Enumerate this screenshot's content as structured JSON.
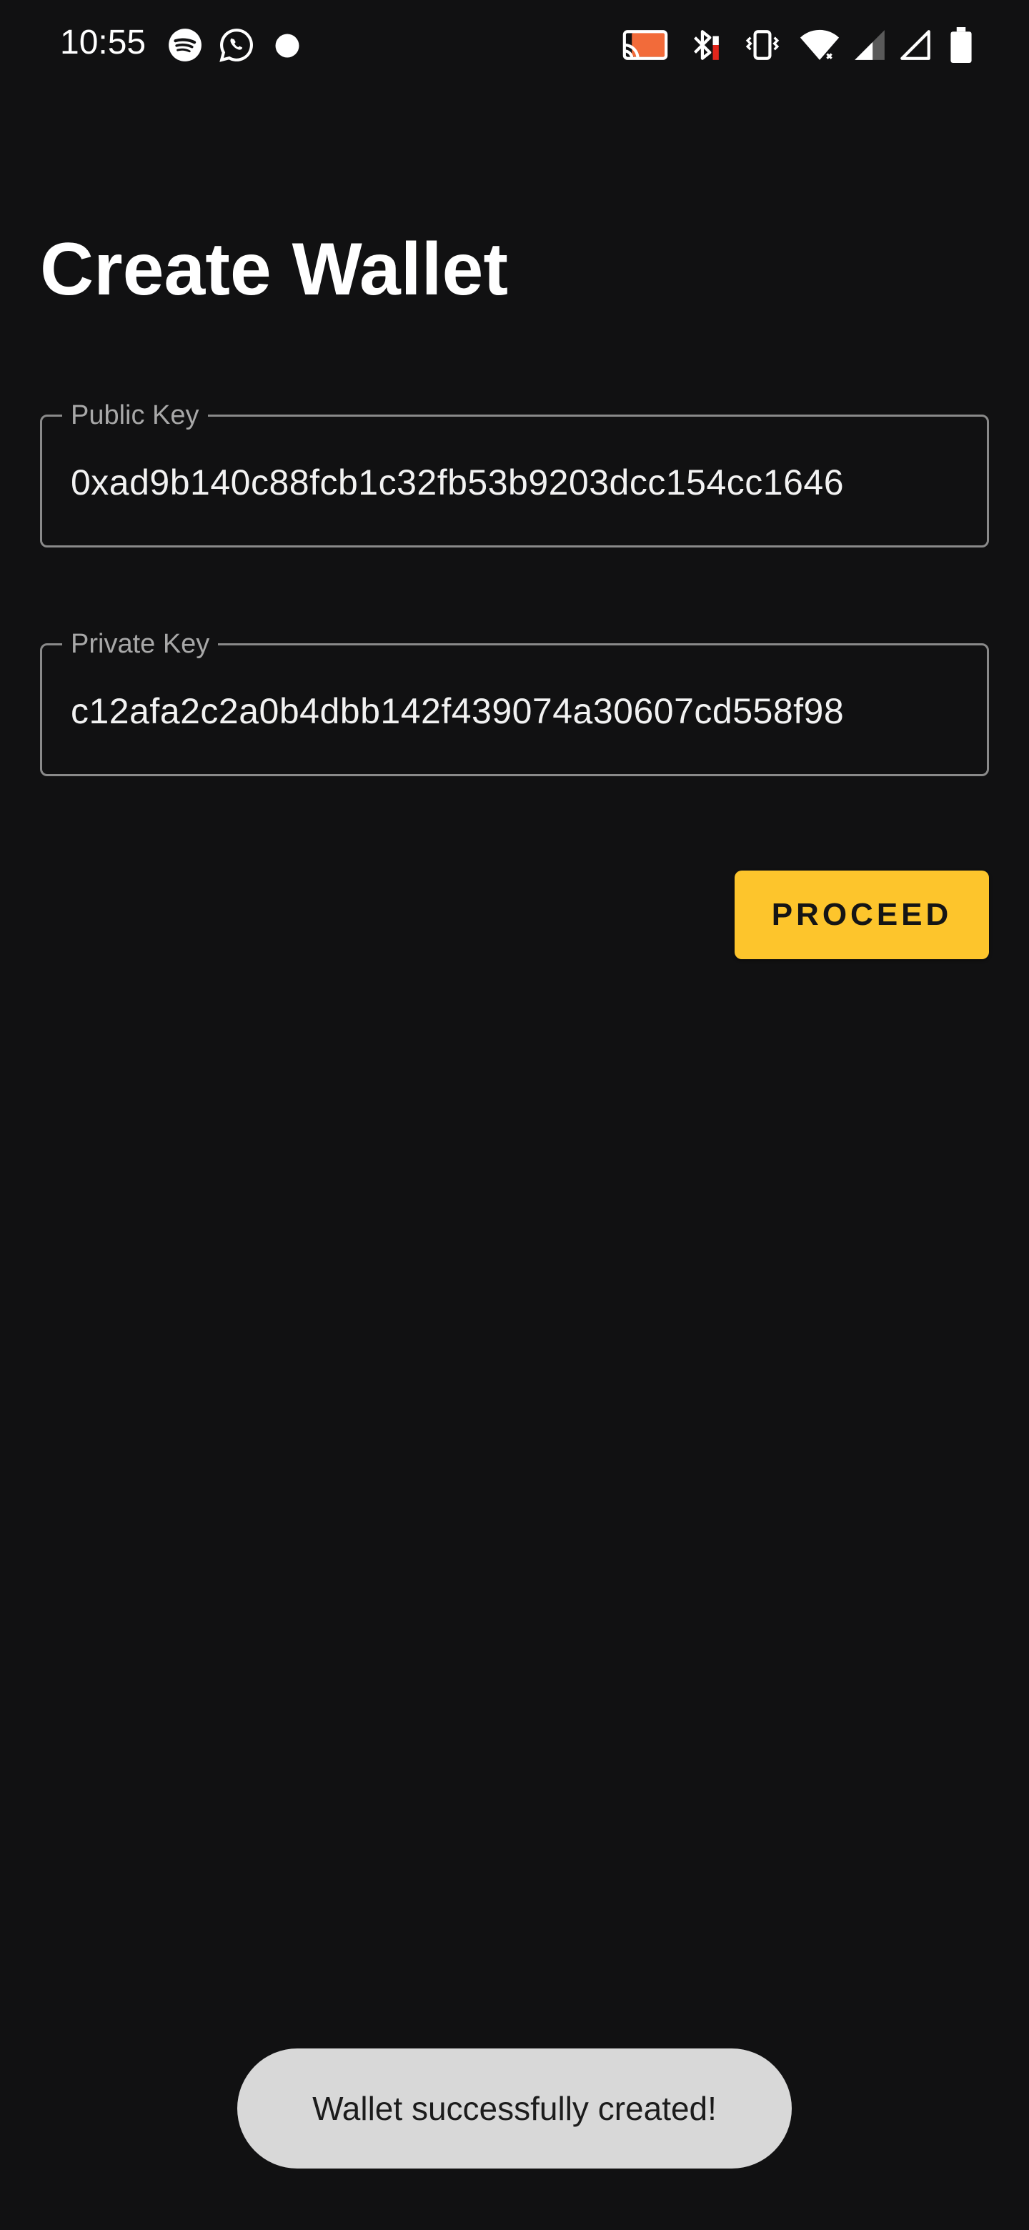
{
  "status_bar": {
    "time": "10:55",
    "left_icons": [
      "spotify-icon",
      "whatsapp-icon",
      "notification-dot-icon"
    ],
    "right_icons": [
      "cast-icon",
      "bluetooth-icon",
      "vibrate-icon",
      "wifi-icon",
      "signal-icon",
      "signal-empty-icon",
      "battery-icon"
    ],
    "cast_accent": "#f26b3a",
    "bluetooth_battery_accent": "#e0261c"
  },
  "page": {
    "title": "Create Wallet"
  },
  "fields": {
    "public_key": {
      "label": "Public Key",
      "value": "0xad9b140c88fcb1c32fb53b9203dcc154cc1646"
    },
    "private_key": {
      "label": "Private Key",
      "value": "c12afa2c2a0b4dbb142f439074a30607cd558f98"
    }
  },
  "actions": {
    "proceed_label": "PROCEED",
    "accent": "#fdc52c"
  },
  "toast": {
    "message": "Wallet successfully created!"
  }
}
